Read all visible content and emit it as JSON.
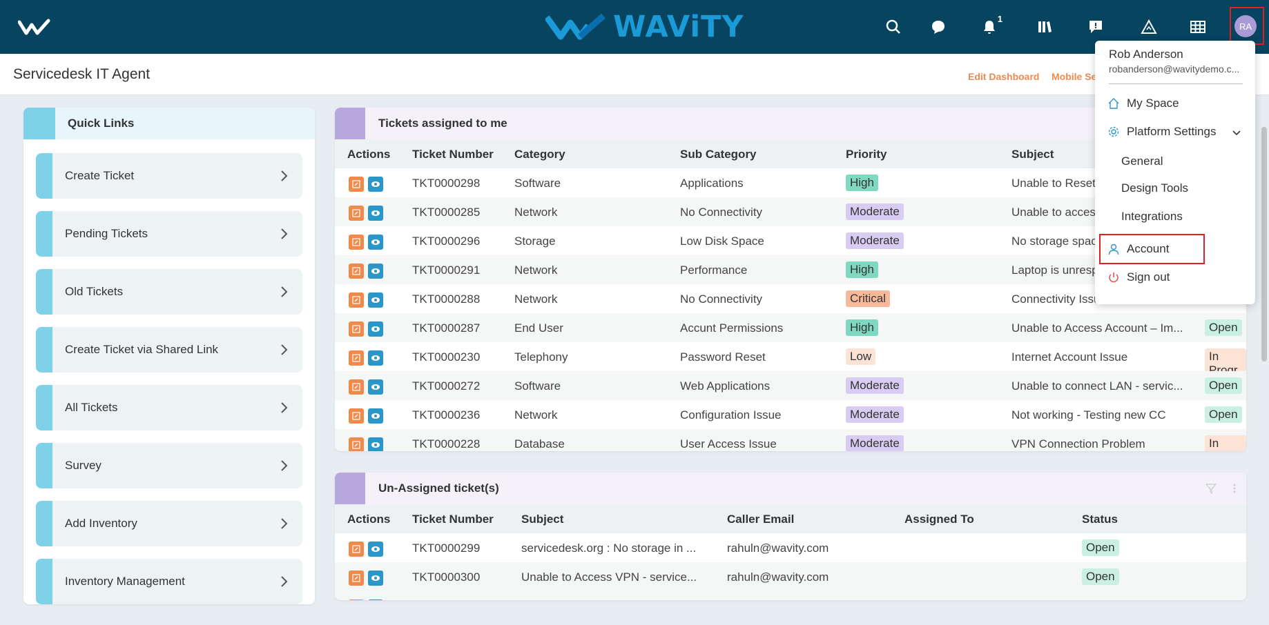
{
  "app": {
    "logo_text": "WAViTY",
    "user_initials": "RA",
    "notification_count": "1"
  },
  "subheader": {
    "title": "Servicedesk IT Agent",
    "edit_dashboard": "Edit Dashboard",
    "mobile_settings": "Mobile Se"
  },
  "quick_links": {
    "title": "Quick Links",
    "items": [
      "Create Ticket",
      "Pending Tickets",
      "Old Tickets",
      "Create Ticket via Shared Link",
      "All Tickets",
      "Survey",
      "Add Inventory",
      "Inventory Management"
    ]
  },
  "assigned": {
    "title": "Tickets assigned to me",
    "columns": [
      "Actions",
      "Ticket Number",
      "Category",
      "Sub Category",
      "Priority",
      "Subject"
    ],
    "rows": [
      {
        "ticket": "TKT0000298",
        "category": "Software",
        "sub": "Applications",
        "priority": "High",
        "subject": "Unable to Reset",
        "status": ""
      },
      {
        "ticket": "TKT0000285",
        "category": "Network",
        "sub": "No Connectivity",
        "priority": "Moderate",
        "subject": "Unable to access",
        "status": ""
      },
      {
        "ticket": "TKT0000296",
        "category": "Storage",
        "sub": "Low Disk Space",
        "priority": "Moderate",
        "subject": "No storage space",
        "status": ""
      },
      {
        "ticket": "TKT0000291",
        "category": "Network",
        "sub": "Performance",
        "priority": "High",
        "subject": "Laptop is unresp",
        "status": ""
      },
      {
        "ticket": "TKT0000288",
        "category": "Network",
        "sub": "No Connectivity",
        "priority": "Critical",
        "subject": "Connectivity Issu",
        "status": ""
      },
      {
        "ticket": "TKT0000287",
        "category": "End User",
        "sub": "Accunt Permissions",
        "priority": "High",
        "subject": "Unable to Access Account – Im...",
        "status": "Open"
      },
      {
        "ticket": "TKT0000230",
        "category": "Telephony",
        "sub": "Password Reset",
        "priority": "Low",
        "subject": "Internet Account Issue",
        "status": "In Progr"
      },
      {
        "ticket": "TKT0000272",
        "category": "Software",
        "sub": "Web Applications",
        "priority": "Moderate",
        "subject": "Unable to connect LAN - servic...",
        "status": "Open"
      },
      {
        "ticket": "TKT0000236",
        "category": "Network",
        "sub": "Configuration Issue",
        "priority": "Moderate",
        "subject": "Not working - Testing new CC",
        "status": "Open"
      },
      {
        "ticket": "TKT0000228",
        "category": "Database",
        "sub": "User Access Issue",
        "priority": "Moderate",
        "subject": "VPN Connection Problem",
        "status": "In Prog"
      }
    ]
  },
  "unassigned": {
    "title": "Un-Assigned ticket(s)",
    "columns": [
      "Actions",
      "Ticket Number",
      "Subject",
      "Caller Email",
      "Assigned To",
      "Status"
    ],
    "rows": [
      {
        "ticket": "TKT0000299",
        "subject": "servicedesk.org : No storage in ...",
        "email": "rahuln@wavity.com",
        "assigned": "",
        "status": "Open"
      },
      {
        "ticket": "TKT0000300",
        "subject": "Unable to Access VPN - service...",
        "email": "rahuln@wavity.com",
        "assigned": "",
        "status": "Open"
      }
    ]
  },
  "dropdown": {
    "name": "Rob Anderson",
    "email": "robanderson@wavitydemo.c...",
    "my_space": "My Space",
    "platform_settings": "Platform Settings",
    "general": "General",
    "design_tools": "Design Tools",
    "integrations": "Integrations",
    "account": "Account",
    "sign_out": "Sign out"
  },
  "colors": {
    "topbar": "#07445f",
    "accent_orange": "#ef8a4f",
    "accent_blue": "#2b96c9",
    "priority_high": "#7fd8c0",
    "priority_moderate": "#d9ccf2",
    "priority_critical": "#f7b99a",
    "priority_low": "#fde3d6",
    "status_open": "#c9f0e3",
    "status_progress": "#fde3d6"
  }
}
